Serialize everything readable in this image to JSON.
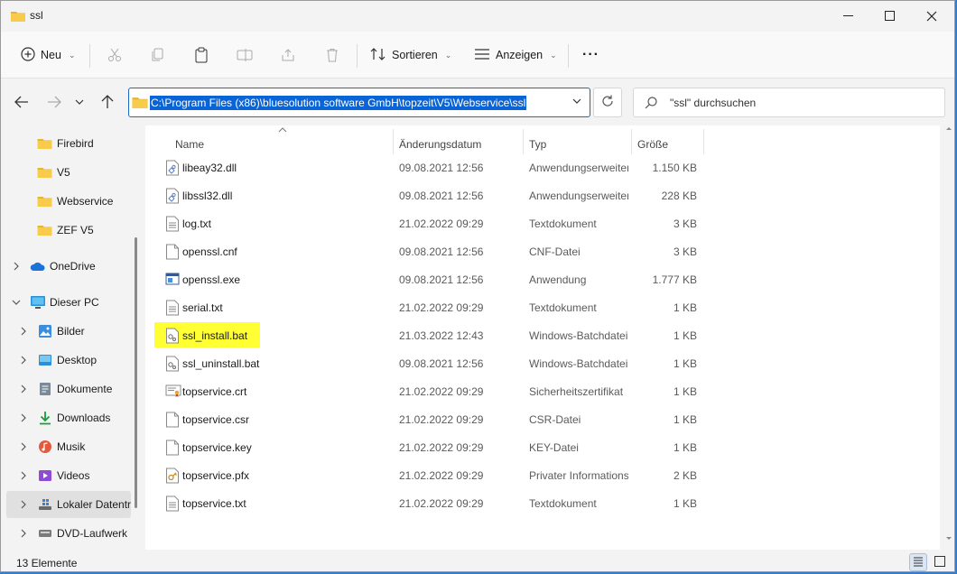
{
  "window": {
    "title": "ssl",
    "accent": "#0a64d6"
  },
  "toolbar": {
    "new_label": "Neu",
    "sort_label": "Sortieren",
    "view_label": "Anzeigen",
    "more_label": "···"
  },
  "address": {
    "path": "C:\\Program Files (x86)\\bluesolution software GmbH\\topzeit\\V5\\Webservice\\ssl",
    "search_placeholder": "\"ssl\" durchsuchen"
  },
  "sidebar": {
    "items": [
      {
        "label": "Firebird",
        "icon": "folder-icon"
      },
      {
        "label": "V5",
        "icon": "folder-icon"
      },
      {
        "label": "Webservice",
        "icon": "folder-icon"
      },
      {
        "label": "ZEF V5",
        "icon": "folder-icon"
      },
      {
        "label": "OneDrive",
        "icon": "cloud-icon"
      },
      {
        "label": "Dieser PC",
        "icon": "pc-icon"
      },
      {
        "label": "Bilder",
        "icon": "pictures-icon"
      },
      {
        "label": "Desktop",
        "icon": "desktop-icon"
      },
      {
        "label": "Dokumente",
        "icon": "documents-icon"
      },
      {
        "label": "Downloads",
        "icon": "download-icon"
      },
      {
        "label": "Musik",
        "icon": "music-icon"
      },
      {
        "label": "Videos",
        "icon": "video-icon"
      },
      {
        "label": "Lokaler Datenträger (C:)",
        "icon": "drive-icon"
      },
      {
        "label": "DVD-Laufwerk",
        "icon": "dvd-icon"
      }
    ]
  },
  "columns": {
    "name": "Name",
    "date": "Änderungsdatum",
    "type": "Typ",
    "size": "Größe"
  },
  "files": [
    {
      "name": "libeay32.dll",
      "date": "09.08.2021 12:56",
      "type": "Anwendungserweiterung",
      "size": "1.150 KB",
      "icon": "dll-icon"
    },
    {
      "name": "libssl32.dll",
      "date": "09.08.2021 12:56",
      "type": "Anwendungserweiterung",
      "size": "228 KB",
      "icon": "dll-icon"
    },
    {
      "name": "log.txt",
      "date": "21.02.2022 09:29",
      "type": "Textdokument",
      "size": "3 KB",
      "icon": "text-file-icon"
    },
    {
      "name": "openssl.cnf",
      "date": "09.08.2021 12:56",
      "type": "CNF-Datei",
      "size": "3 KB",
      "icon": "file-icon"
    },
    {
      "name": "openssl.exe",
      "date": "09.08.2021 12:56",
      "type": "Anwendung",
      "size": "1.777 KB",
      "icon": "exe-icon"
    },
    {
      "name": "serial.txt",
      "date": "21.02.2022 09:29",
      "type": "Textdokument",
      "size": "1 KB",
      "icon": "text-file-icon"
    },
    {
      "name": "ssl_install.bat",
      "date": "21.03.2022 12:43",
      "type": "Windows-Batchdatei",
      "size": "1 KB",
      "icon": "batch-file-icon",
      "highlighted": true
    },
    {
      "name": "ssl_uninstall.bat",
      "date": "09.08.2021 12:56",
      "type": "Windows-Batchdatei",
      "size": "1 KB",
      "icon": "batch-file-icon"
    },
    {
      "name": "topservice.crt",
      "date": "21.02.2022 09:29",
      "type": "Sicherheitszertifikat",
      "size": "1 KB",
      "icon": "certificate-icon"
    },
    {
      "name": "topservice.csr",
      "date": "21.02.2022 09:29",
      "type": "CSR-Datei",
      "size": "1 KB",
      "icon": "file-icon"
    },
    {
      "name": "topservice.key",
      "date": "21.02.2022 09:29",
      "type": "KEY-Datei",
      "size": "1 KB",
      "icon": "file-icon"
    },
    {
      "name": "topservice.pfx",
      "date": "21.02.2022 09:29",
      "type": "Privater Informationsaustausch",
      "size": "2 KB",
      "icon": "pfx-icon"
    },
    {
      "name": "topservice.txt",
      "date": "21.02.2022 09:29",
      "type": "Textdokument",
      "size": "1 KB",
      "icon": "text-file-icon"
    }
  ],
  "status": {
    "count_text": "13 Elemente"
  }
}
